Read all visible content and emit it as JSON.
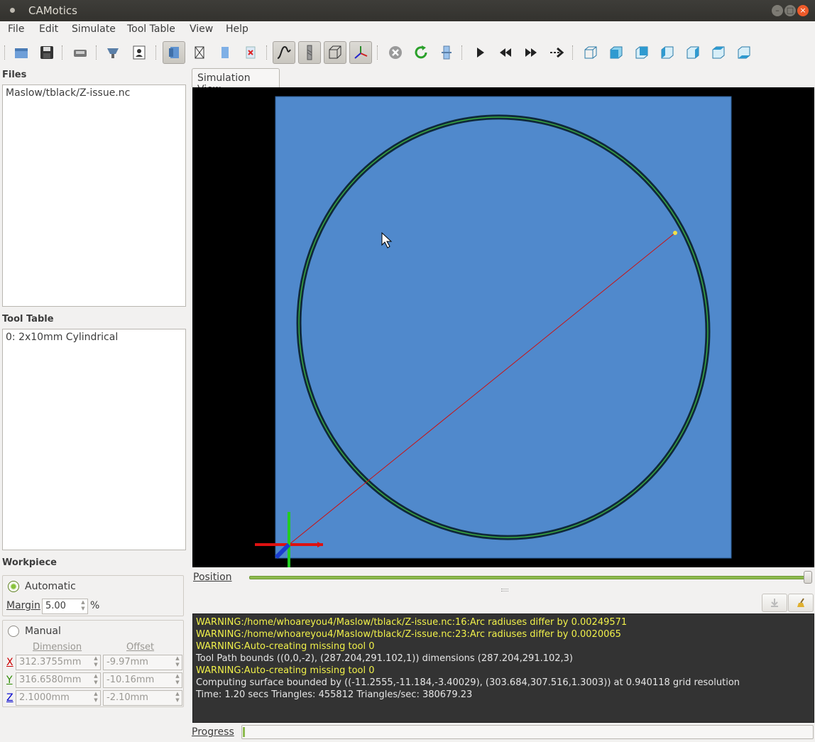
{
  "window": {
    "title": "CAMotics"
  },
  "menu": [
    "File",
    "Edit",
    "Simulate",
    "Tool Table",
    "View",
    "Help"
  ],
  "toolbar": {
    "icons": [
      "open-icon",
      "save-icon",
      "export-icon",
      "import-tool-icon",
      "user-icon",
      "view-mode-icon",
      "wireframe-icon",
      "workpiece-icon",
      "clear-icon",
      "toolpath-icon",
      "tool-icon",
      "bbox-icon",
      "axes-icon",
      "stop-icon",
      "reload-icon",
      "settings-icon",
      "play-icon",
      "rewind-icon",
      "fast-forward-icon",
      "step-icon",
      "view-iso",
      "view-front",
      "view-back",
      "view-left",
      "view-right",
      "view-top",
      "view-bottom"
    ]
  },
  "files": {
    "label": "Files",
    "items": [
      "Maslow/tblack/Z-issue.nc"
    ]
  },
  "tool_table": {
    "label": "Tool Table",
    "items": [
      "0: 2x10mm Cylindrical"
    ]
  },
  "workpiece": {
    "label": "Workpiece",
    "automatic_label": "Automatic",
    "margin_label": "Margin",
    "margin_value": "5.00",
    "margin_unit": "%",
    "manual_label": "Manual",
    "dimension_header": "Dimension",
    "offset_header": "Offset",
    "axes": [
      {
        "name": "X",
        "dimension": "312.3755mm",
        "offset": "-9.97mm",
        "color": "#cc0000"
      },
      {
        "name": "Y",
        "dimension": "316.6580mm",
        "offset": "-10.16mm",
        "color": "#2c8a00"
      },
      {
        "name": "Z",
        "dimension": "2.1000mm",
        "offset": "-2.10mm",
        "color": "#0000cc"
      }
    ]
  },
  "simulation_tab": "Simulation View",
  "position_label": "Position",
  "position_value": 1.0,
  "console": [
    {
      "text": "WARNING:/home/whoareyou4/Maslow/tblack/Z-issue.nc:16:Arc radiuses differ by 0.00249571",
      "color": "#f1f14a"
    },
    {
      "text": "WARNING:/home/whoareyou4/Maslow/tblack/Z-issue.nc:23:Arc radiuses differ by 0.0020065",
      "color": "#f1f14a"
    },
    {
      "text": "WARNING:Auto-creating missing tool 0",
      "color": "#f1f14a"
    },
    {
      "text": "Tool Path bounds ((0,0,-2), (287.204,291.102,1)) dimensions (287.204,291.102,3)",
      "color": "#e6e6e6"
    },
    {
      "text": "WARNING:Auto-creating missing tool 0",
      "color": "#f1f14a"
    },
    {
      "text": "Computing surface bounded by ((-11.2555,-11.184,-3.40029), (303.684,307.516,1.3003)) at 0.940118 grid resolution",
      "color": "#e6e6e6"
    },
    {
      "text": "Time: 1.20 secs Triangles: 455812 Triangles/sec: 380679.23",
      "color": "#e6e6e6"
    }
  ],
  "progress_label": "Progress",
  "progress_value": 0.0,
  "colors": {
    "workpiece": "#5089cc",
    "toolpath_cut": "#0f2a3a",
    "toolpath_line": "#3fb83f",
    "rapid_move": "#cc1111",
    "view_bg": "#000000"
  }
}
